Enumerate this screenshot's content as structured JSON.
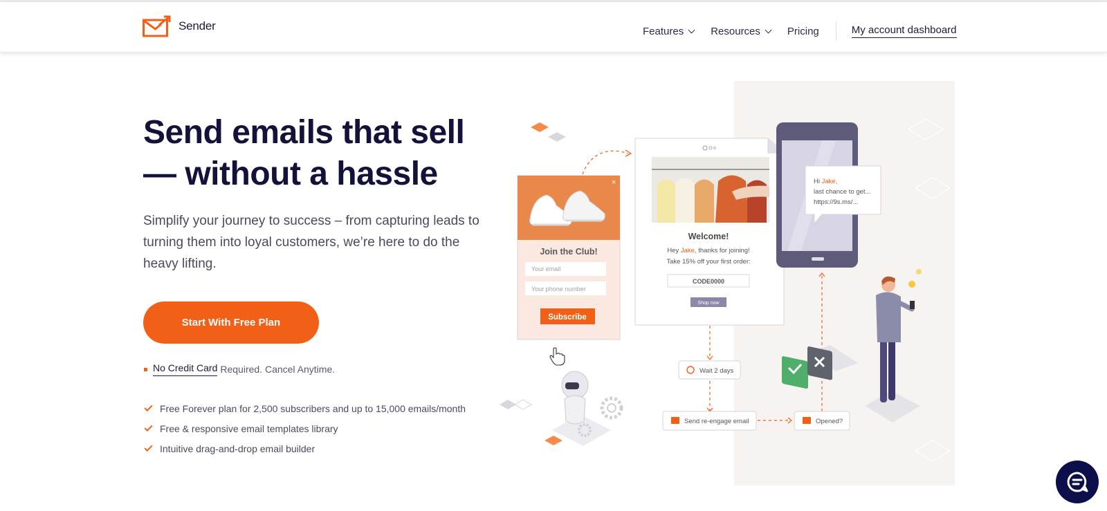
{
  "brand": {
    "name": "Sender",
    "accent": "#f26018",
    "ink": "#12123a"
  },
  "nav": {
    "items": [
      {
        "label": "Features",
        "has_dropdown": true
      },
      {
        "label": "Resources",
        "has_dropdown": true
      },
      {
        "label": "Pricing",
        "has_dropdown": false
      }
    ],
    "dashboard_link": "My account dashboard"
  },
  "hero": {
    "headline_line1": "Send emails that sell",
    "headline_line2": "— without a hassle",
    "subtitle": "Simplify your journey to success – from capturing leads to turning them into loyal customers, we’re here to do the heavy lifting.",
    "cta_label": "Start With Free Plan",
    "no_cc_link": "No Credit Card",
    "no_cc_rest": "Required. Cancel Anytime.",
    "features": [
      "Free Forever plan for 2,500 subscribers and up to 15,000 emails/month",
      "Free & responsive email templates library",
      "Intuitive drag-and-drop email builder"
    ]
  },
  "illustration": {
    "popup": {
      "title": "Join the Club!",
      "email_placeholder": "Your email",
      "phone_placeholder": "Your phone number",
      "subscribe_label": "Subscribe",
      "close": "×"
    },
    "email": {
      "title": "Welcome!",
      "line1_pre": "Hey ",
      "line1_name": "Jake,",
      "line1_post": " thanks for joining!",
      "line2": "Take 15% off your first order:",
      "code": "CODE0000",
      "shop_label": "Shop now"
    },
    "sms": {
      "hi": "Hi ",
      "name": "Jake,",
      "line2": "last chance to get...",
      "line3": "https://9s.ms/..."
    },
    "flow": {
      "wait": "Wait 2 days",
      "reengage": "Send re-engage email",
      "opened": "Opened?"
    }
  },
  "chat_icon": "chat-bubble-icon"
}
